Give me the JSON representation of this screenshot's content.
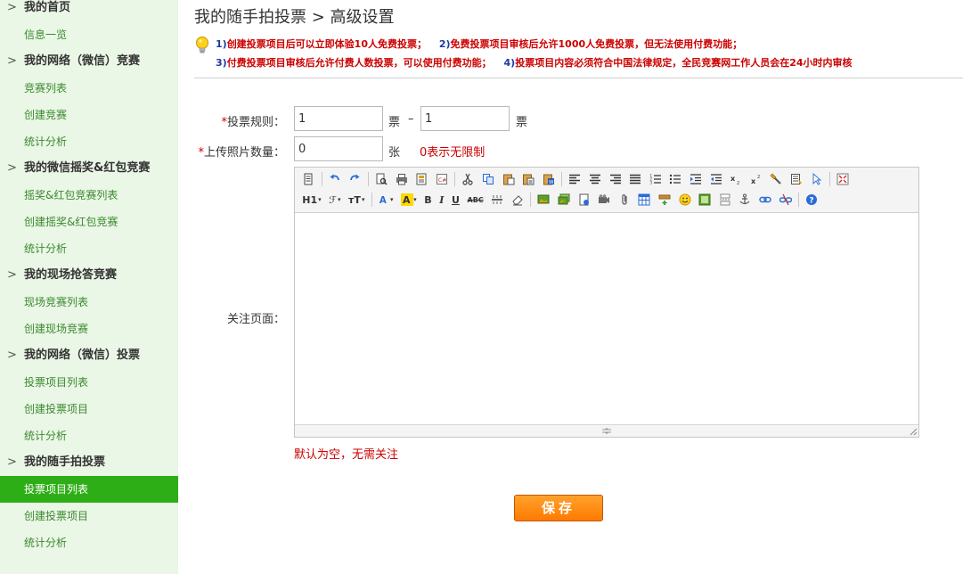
{
  "sidebar": {
    "groups": [
      {
        "label": "我的首页",
        "items": [
          "信息一览"
        ]
      },
      {
        "label": "我的网络（微信）竞赛",
        "items": [
          "竞赛列表",
          "创建竞赛",
          "统计分析"
        ]
      },
      {
        "label": "我的微信摇奖&红包竞赛",
        "items": [
          "摇奖&红包竞赛列表",
          "创建摇奖&红包竞赛",
          "统计分析"
        ]
      },
      {
        "label": "我的现场抢答竞赛",
        "items": [
          "现场竞赛列表",
          "创建现场竞赛"
        ]
      },
      {
        "label": "我的网络（微信）投票",
        "items": [
          "投票项目列表",
          "创建投票项目",
          "统计分析"
        ]
      },
      {
        "label": "我的随手拍投票",
        "items": [
          "投票项目列表",
          "创建投票项目",
          "统计分析"
        ]
      }
    ],
    "active_item": "投票项目列表"
  },
  "header": {
    "title": "我的随手拍投票 > 高级设置"
  },
  "tips": {
    "line1": [
      {
        "num": "1)",
        "text": "创建投票项目后可以立即体验10人免费投票；"
      },
      {
        "num": "2)",
        "text": "免费投票项目审核后允许1000人免费投票，但无法使用付费功能；"
      }
    ],
    "line2": [
      {
        "num": "3)",
        "text": "付费投票项目审核后允许付费人数投票，可以使用付费功能；"
      },
      {
        "num": "4)",
        "text": "投票项目内容必须符合中国法律规定，全民竞赛网工作人员会在24小时内审核"
      }
    ]
  },
  "form": {
    "vote_rule": {
      "label": "投票规则：",
      "required_mark": "*",
      "min": "1",
      "max": "1",
      "unit": "票",
      "dash": "–"
    },
    "photo_count": {
      "label": "上传照片数量：",
      "required_mark": "*",
      "value": "0",
      "unit": "张",
      "hint": "0表示无限制"
    },
    "follow_page": {
      "label": "关注页面：",
      "hint": "默认为空，无需关注"
    }
  },
  "editor": {
    "row2_text": {
      "heading": "H1",
      "font": "ℱ",
      "size": "тT",
      "bold": "B",
      "italic": "I",
      "underline": "U",
      "strike": "ABC"
    }
  },
  "save_label": "保存",
  "colors": {
    "sidebar_bg": "#eaf6e6",
    "active_bg": "#2eae16",
    "link": "#3a8a2e",
    "accent_red": "#cc0000",
    "tip_num": "#1c3aa8",
    "button": "#ff8a10"
  }
}
